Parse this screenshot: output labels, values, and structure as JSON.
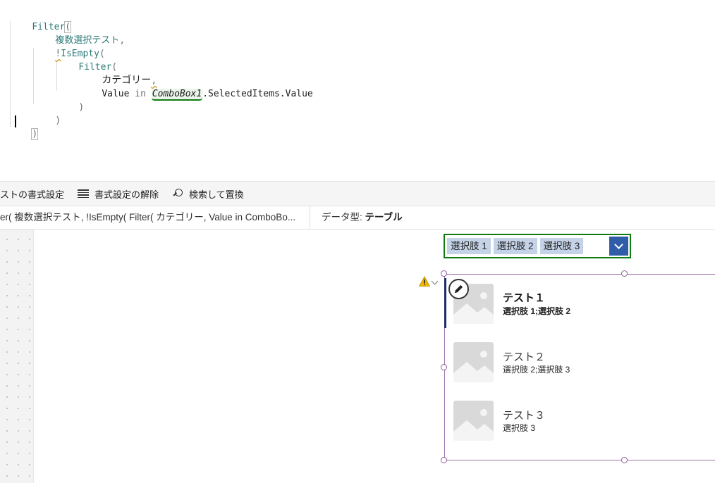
{
  "editor": {
    "lines": [
      {
        "fn": "Filter",
        "paren": "("
      },
      {
        "ident": "複数選択テスト",
        "tail": ","
      },
      {
        "bang": "!",
        "fn": "IsEmpty",
        "paren": "("
      },
      {
        "fn": "Filter",
        "paren": "("
      },
      {
        "plain": "カテゴリー",
        "tail": ","
      },
      {
        "plain": "Value",
        "kw": "in",
        "control": "ComboBox1",
        "rest": ".SelectedItems.Value"
      },
      {
        "close": ")"
      },
      {
        "close": ")"
      },
      {
        "close": ")"
      }
    ]
  },
  "toolbar": {
    "format_text_label": "ストの書式設定",
    "remove_format_label": "書式設定の解除",
    "find_replace_label": "検索して置換"
  },
  "summary": {
    "formula_preview": "er( 複数選択テスト, !IsEmpty( Filter( カテゴリー, Value in ComboBo...",
    "datatype_label": "データ型:",
    "datatype_value": "テーブル"
  },
  "combobox": {
    "chips": [
      "選択肢 1",
      "選択肢 2",
      "選択肢 3"
    ],
    "colors": {
      "border": "#107c10",
      "chip": "#c5d3e8",
      "button": "#2f5da8"
    }
  },
  "gallery": {
    "items": [
      {
        "title": "テスト１",
        "subtitle": "選択肢 1;選択肢 2"
      },
      {
        "title": "テスト２",
        "subtitle": "選択肢 2;選択肢 3"
      },
      {
        "title": "テスト３",
        "subtitle": "選択肢 3"
      }
    ],
    "icons": {
      "warning": "warning-icon",
      "edit": "pencil-icon",
      "image": "image-placeholder-icon"
    }
  }
}
